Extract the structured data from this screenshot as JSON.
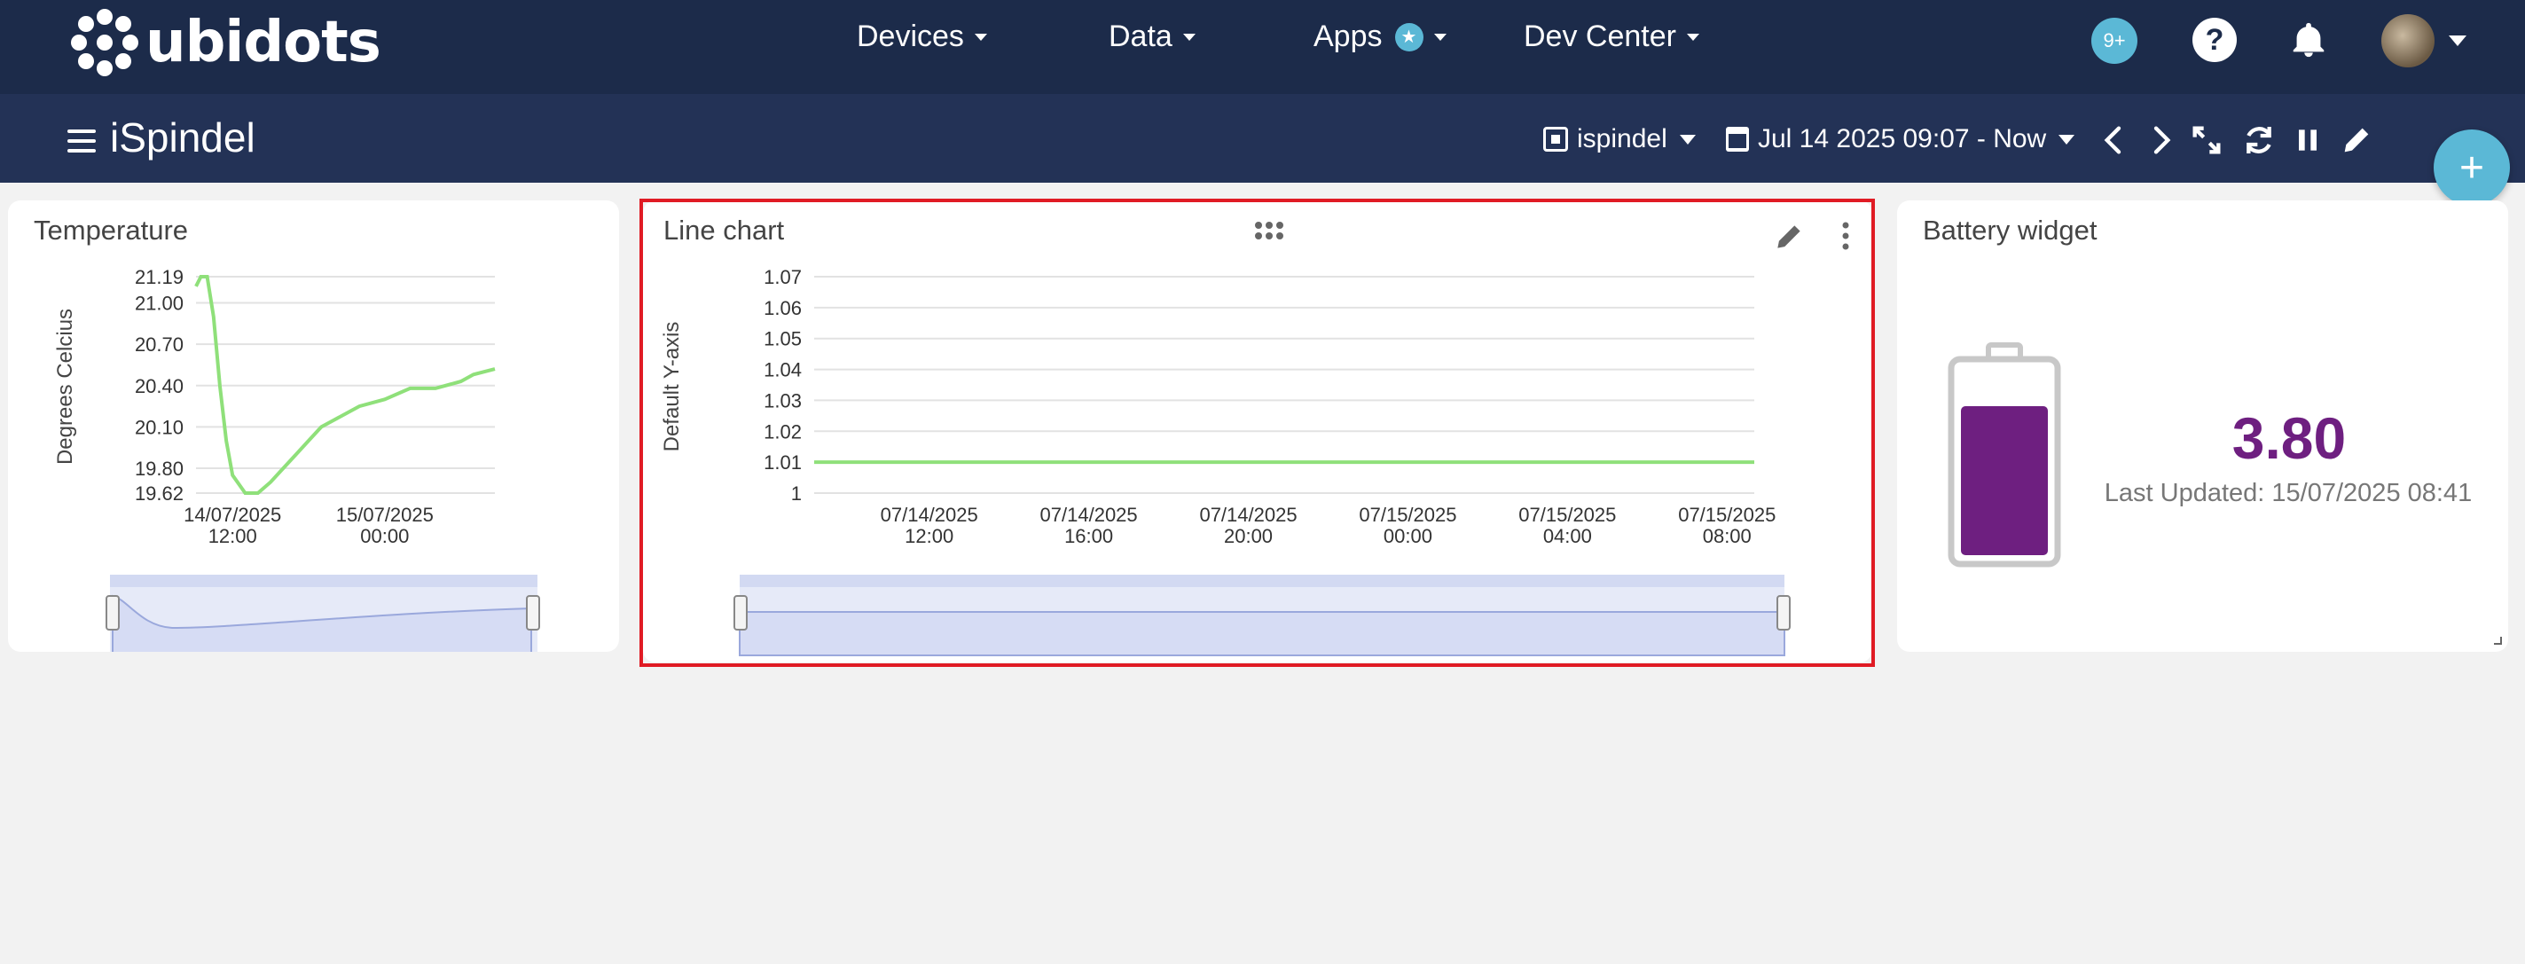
{
  "app": {
    "logo_text": "ubidots"
  },
  "nav": {
    "items": [
      {
        "label": "Devices"
      },
      {
        "label": "Data"
      },
      {
        "label": "Apps"
      },
      {
        "label": "Dev Center"
      }
    ],
    "notifications_badge": "9+",
    "help_label": "?"
  },
  "header": {
    "dashboard_title": "iSpindel",
    "device_selector": "ispindel",
    "date_range": "Jul 14 2025 09:07 - Now",
    "add_button": "+"
  },
  "widgets": {
    "temperature": {
      "title": "Temperature"
    },
    "line_chart": {
      "title": "Line chart"
    },
    "battery": {
      "title": "Battery widget",
      "value": "3.80",
      "last_updated": "Last Updated: 15/07/2025 08:41",
      "level": 0.8
    }
  },
  "colors": {
    "nav_bg": "#1c2b4a",
    "subnav_bg": "#233256",
    "accent": "#5bb8d6",
    "series": "#8fe07a",
    "battery": "#6e1f80",
    "selection": "#e01b24"
  },
  "chart_data": [
    {
      "type": "line",
      "title": "Temperature",
      "ylabel": "Degrees Celcius",
      "yticks": [
        21.19,
        21.0,
        20.7,
        20.4,
        20.1,
        19.8,
        19.62
      ],
      "ytick_labels": [
        "21.19",
        "21.00",
        "20.70",
        "20.40",
        "20.10",
        "19.80",
        "19.62"
      ],
      "ylim": [
        19.62,
        21.19
      ],
      "xtick_labels": [
        [
          "14/07/2025",
          "12:00"
        ],
        [
          "15/07/2025",
          "00:00"
        ]
      ],
      "x": [
        "2025-07-14 09:07",
        "2025-07-14 09:30",
        "2025-07-14 10:00",
        "2025-07-14 10:30",
        "2025-07-14 11:00",
        "2025-07-14 11:30",
        "2025-07-14 12:00",
        "2025-07-14 13:00",
        "2025-07-14 14:00",
        "2025-07-14 15:00",
        "2025-07-14 16:00",
        "2025-07-14 17:00",
        "2025-07-14 18:00",
        "2025-07-14 19:00",
        "2025-07-14 20:00",
        "2025-07-14 21:00",
        "2025-07-14 22:00",
        "2025-07-15 00:00",
        "2025-07-15 02:00",
        "2025-07-15 04:00",
        "2025-07-15 06:00",
        "2025-07-15 07:00",
        "2025-07-15 08:41"
      ],
      "values": [
        21.12,
        21.19,
        21.19,
        20.9,
        20.4,
        20.0,
        19.75,
        19.62,
        19.62,
        19.7,
        19.8,
        19.9,
        20.0,
        20.1,
        20.15,
        20.2,
        20.25,
        20.3,
        20.38,
        20.38,
        20.43,
        20.48,
        20.52
      ],
      "grid": true
    },
    {
      "type": "line",
      "title": "Line chart",
      "ylabel": "Default Y-axis",
      "yticks": [
        1,
        1.01,
        1.02,
        1.03,
        1.04,
        1.05,
        1.06,
        1.07
      ],
      "ytick_labels": [
        "1",
        "1.01",
        "1.02",
        "1.03",
        "1.04",
        "1.05",
        "1.06",
        "1.07"
      ],
      "ylim": [
        1,
        1.07
      ],
      "xtick_labels": [
        [
          "07/14/2025",
          "12:00"
        ],
        [
          "07/14/2025",
          "16:00"
        ],
        [
          "07/14/2025",
          "20:00"
        ],
        [
          "07/15/2025",
          "00:00"
        ],
        [
          "07/15/2025",
          "04:00"
        ],
        [
          "07/15/2025",
          "08:00"
        ]
      ],
      "x": [
        "2025-07-14 09:07",
        "2025-07-15 08:41"
      ],
      "values": [
        1.01,
        1.01
      ],
      "grid": true
    }
  ]
}
